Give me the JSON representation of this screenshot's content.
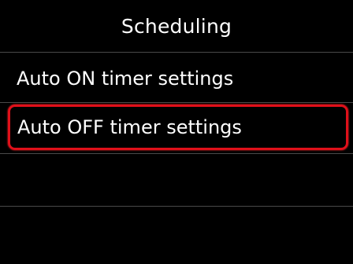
{
  "header": {
    "title": "Scheduling"
  },
  "menu": {
    "items": [
      {
        "label": "Auto ON timer settings",
        "selected": false
      },
      {
        "label": "Auto OFF timer settings",
        "selected": true
      },
      {
        "label": ""
      },
      {
        "label": ""
      }
    ]
  },
  "colors": {
    "background": "#000000",
    "text": "#ffffff",
    "divider": "#4a4a4a",
    "selection": "#e0101a"
  }
}
